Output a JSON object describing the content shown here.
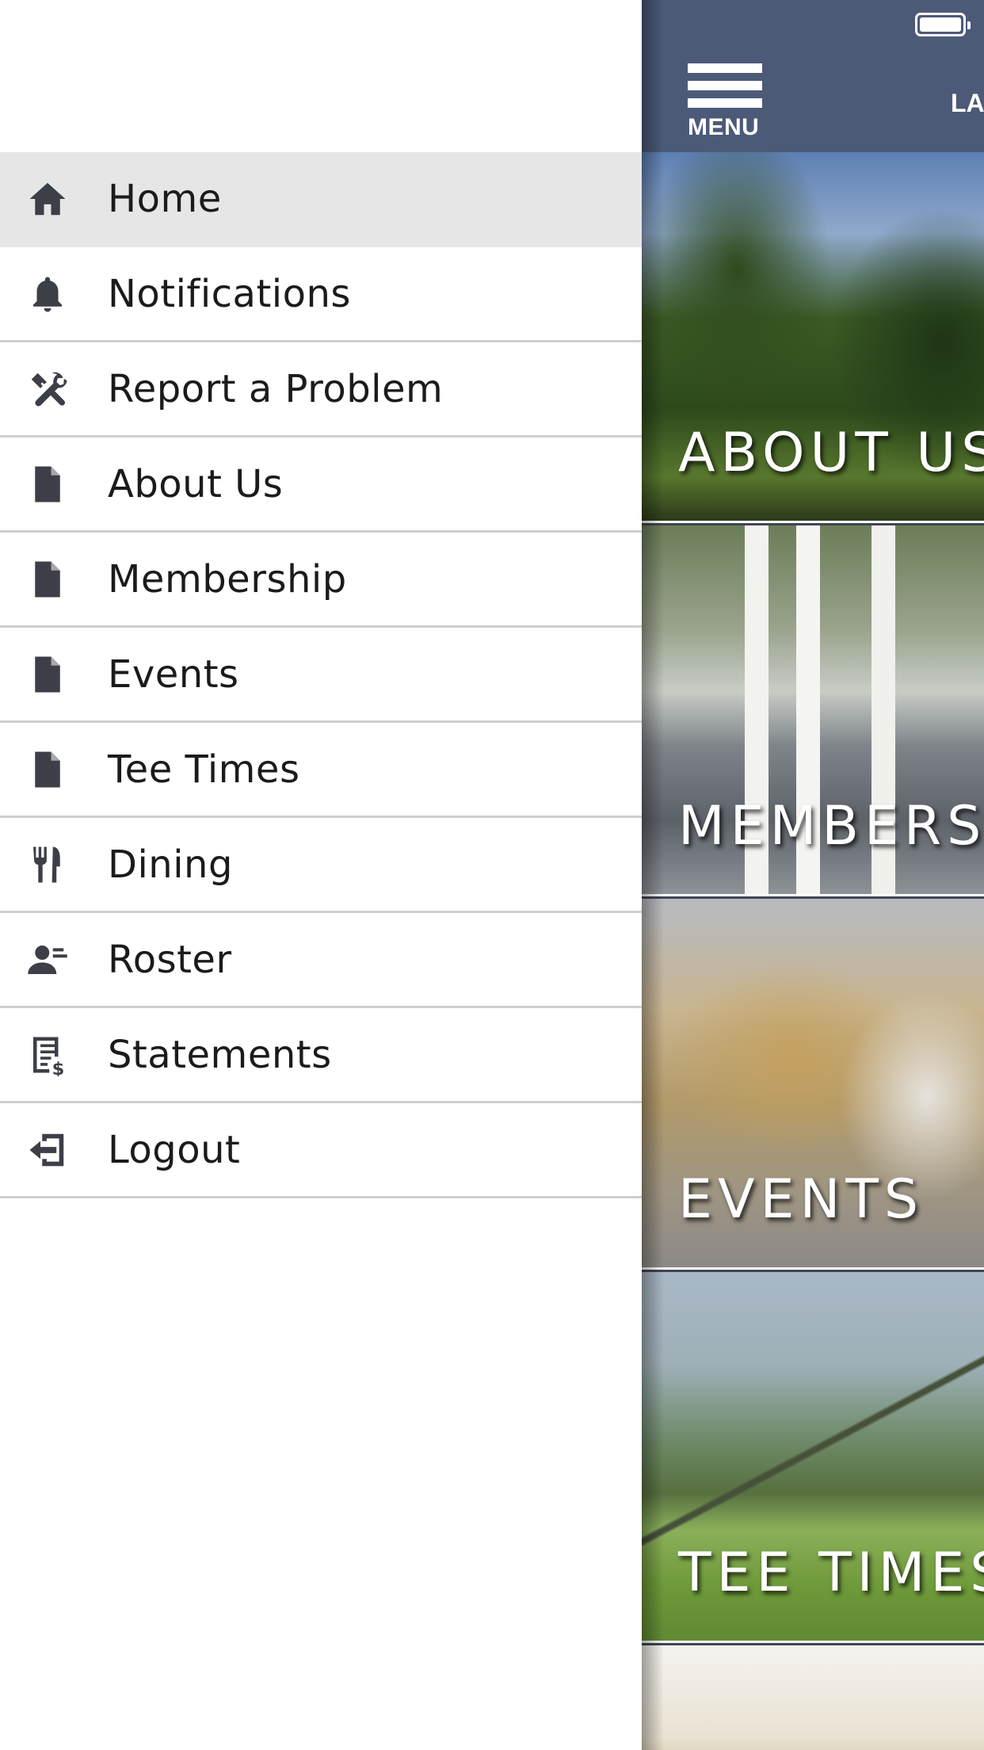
{
  "drawer": {
    "items": [
      {
        "label": "Home",
        "icon": "home-icon",
        "active": true
      },
      {
        "label": "Notifications",
        "icon": "bell-icon",
        "active": false
      },
      {
        "label": "Report a Problem",
        "icon": "tools-icon",
        "active": false
      },
      {
        "label": "About Us",
        "icon": "document-icon",
        "active": false
      },
      {
        "label": "Membership",
        "icon": "document-icon",
        "active": false
      },
      {
        "label": "Events",
        "icon": "document-icon",
        "active": false
      },
      {
        "label": "Tee Times",
        "icon": "document-icon",
        "active": false
      },
      {
        "label": "Dining",
        "icon": "utensils-icon",
        "active": false
      },
      {
        "label": "Roster",
        "icon": "roster-icon",
        "active": false
      },
      {
        "label": "Statements",
        "icon": "statement-icon",
        "active": false
      },
      {
        "label": "Logout",
        "icon": "logout-icon",
        "active": false
      }
    ]
  },
  "header": {
    "menu_label": "MENU",
    "title_partial": "LA",
    "background": "#4c5a78"
  },
  "tiles": [
    {
      "label": "ABOUT US"
    },
    {
      "label": "MEMBERSHIP"
    },
    {
      "label": "EVENTS"
    },
    {
      "label": "TEE TIMES"
    }
  ],
  "colors": {
    "active_row": "#e6e6e6",
    "icon": "#3c3f47",
    "divider": "#cfcfcf"
  }
}
